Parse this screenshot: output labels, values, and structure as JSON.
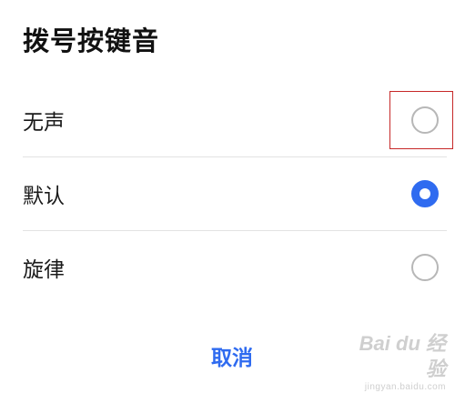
{
  "dialog": {
    "title": "拨号按键音",
    "options": [
      {
        "label": "无声",
        "selected": false
      },
      {
        "label": "默认",
        "selected": true
      },
      {
        "label": "旋律",
        "selected": false
      }
    ],
    "cancel_label": "取消"
  },
  "watermark": {
    "main": "Bai du 经验",
    "sub": "jingyan.baidu.com"
  },
  "colors": {
    "accent": "#2f6bf0",
    "radio_border": "#b7b7b7",
    "highlight": "#c62828",
    "divider": "#e3e3e3"
  }
}
